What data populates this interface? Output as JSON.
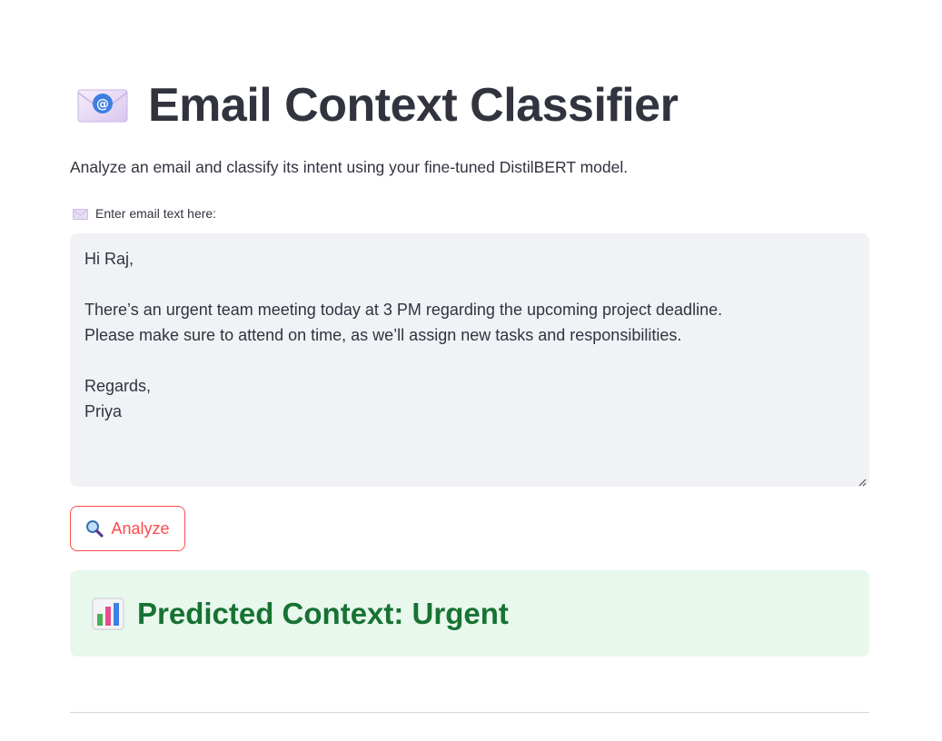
{
  "header": {
    "title_icon": "envelope-at-icon",
    "title": "Email Context Classifier",
    "subtitle": "Analyze an email and classify its intent using your fine-tuned DistilBERT model."
  },
  "input": {
    "label_icon": "envelope-icon",
    "label": "Enter email text here:",
    "value": "Hi Raj,\n\nThere’s an urgent team meeting today at 3 PM regarding the upcoming project deadline.\nPlease make sure to attend on time, as we’ll assign new tasks and responsibilities.\n\nRegards,\nPriya"
  },
  "actions": {
    "analyze_icon": "magnifier-icon",
    "analyze_label": "Analyze"
  },
  "result": {
    "icon": "bar-chart-icon",
    "text": "Predicted Context: Urgent"
  },
  "colors": {
    "primary": "#ff4b4b",
    "text": "#31333f",
    "input_bg": "#f0f2f6",
    "success_bg": "#e8f8ec",
    "success_text": "#177233"
  }
}
